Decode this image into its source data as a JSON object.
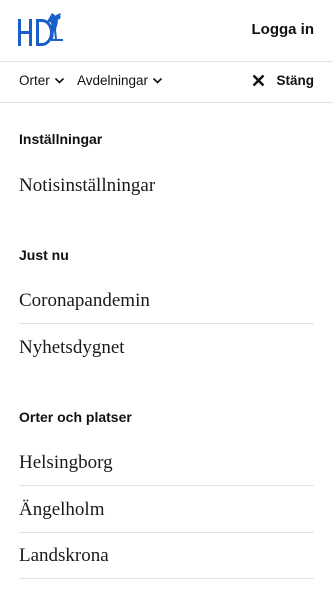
{
  "header": {
    "logo_text": "HD",
    "login_label": "Logga in",
    "logo_color": "#1a5ec9"
  },
  "navbar": {
    "places_label": "Orter",
    "departments_label": "Avdelningar",
    "close_label": "Stäng"
  },
  "sections": {
    "settings": {
      "title": "Inställningar",
      "items": [
        "Notisinställningar"
      ]
    },
    "just_now": {
      "title": "Just nu",
      "items": [
        "Coronapandemin",
        "Nyhetsdygnet"
      ]
    },
    "places": {
      "title": "Orter och platser",
      "items": [
        "Helsingborg",
        "Ängelholm",
        "Landskrona"
      ]
    }
  }
}
